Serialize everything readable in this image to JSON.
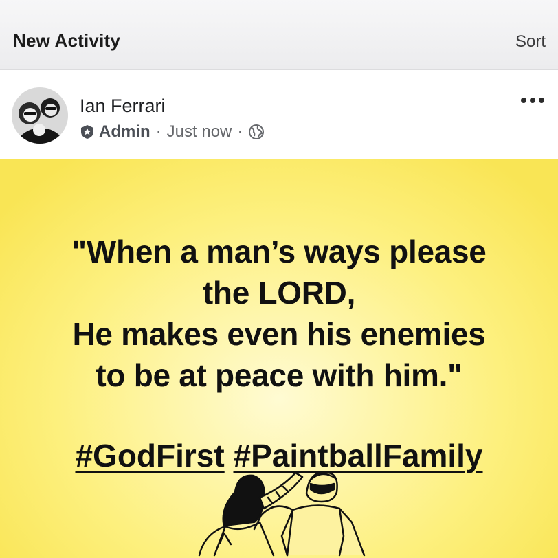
{
  "header": {
    "title": "New Activity",
    "sort_label": "Sort"
  },
  "post": {
    "author": "Ian Ferrari",
    "role": "Admin",
    "separator": "·",
    "time": "Just now",
    "icons": {
      "role_icon": "admin-badge-icon",
      "audience_icon": "globe-icon",
      "menu_icon": "more-options-icon"
    }
  },
  "image": {
    "quote_lines": [
      "\"When a man’s ways please",
      "the LORD,",
      "He makes even his enemies",
      "to be at peace with him.\""
    ],
    "hashtags": [
      "#GodFirst",
      "#PaintballFamily"
    ]
  },
  "colors": {
    "background_yellow": "#fdf07e",
    "text": "#111111",
    "meta_gray": "#65676b"
  }
}
